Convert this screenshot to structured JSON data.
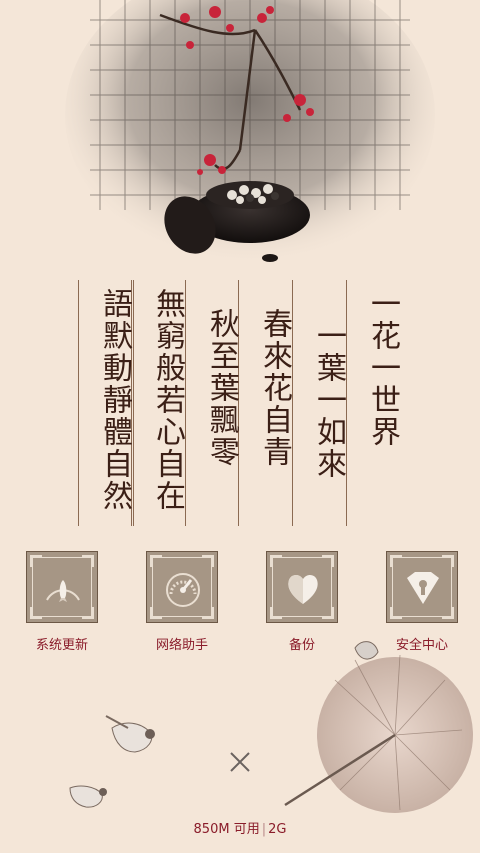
{
  "poem": {
    "columns": [
      "一花一世界",
      "一葉一如來",
      "春來花自青",
      "秋至葉飄零",
      "無窮般若心自在",
      "語默動靜體自然"
    ]
  },
  "tools": [
    {
      "label": "系统更新",
      "icon": "rocket-icon"
    },
    {
      "label": "网络助手",
      "icon": "speedometer-icon"
    },
    {
      "label": "备份",
      "icon": "heart-icon"
    },
    {
      "label": "安全中心",
      "icon": "diamond-lock-icon"
    }
  ],
  "status": {
    "memory": "850M 可用",
    "network": "2G"
  },
  "colors": {
    "background": "#f4e6d8",
    "accent": "#8a1c2a",
    "tile": "#a69685"
  }
}
